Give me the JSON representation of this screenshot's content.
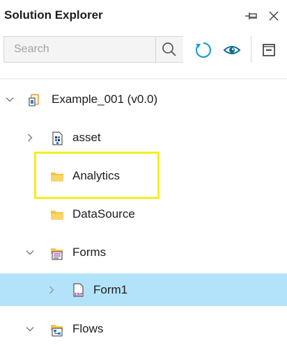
{
  "panel": {
    "title": "Solution Explorer",
    "pin_icon": "pin-icon",
    "close_icon": "close-icon"
  },
  "toolbar": {
    "search_placeholder": "Search",
    "search_value": "",
    "search_icon": "search-icon",
    "refresh_icon": "refresh-icon",
    "view_icon": "eye-icon",
    "collapse_icon": "collapse-all-icon",
    "accent": "#1aa3c9"
  },
  "tree": {
    "items": [
      {
        "label": "Example_001 (v0.0)",
        "expanded": true,
        "icon": "project-icon"
      },
      {
        "label": "asset",
        "expanded": false,
        "icon": "asset-icon"
      },
      {
        "label": "Analytics",
        "icon": "folder-icon"
      },
      {
        "label": "DataSource",
        "icon": "folder-icon"
      },
      {
        "label": "Forms",
        "expanded": true,
        "icon": "forms-folder-icon"
      },
      {
        "label": "Form1",
        "expanded": false,
        "selected": true,
        "icon": "erf-file-icon"
      },
      {
        "label": "Flows",
        "expanded": true,
        "icon": "flows-folder-icon"
      }
    ]
  },
  "colors": {
    "selected_row": "#b3e3fa",
    "folder": "#f6c443",
    "highlight": "#f5ee1e"
  }
}
